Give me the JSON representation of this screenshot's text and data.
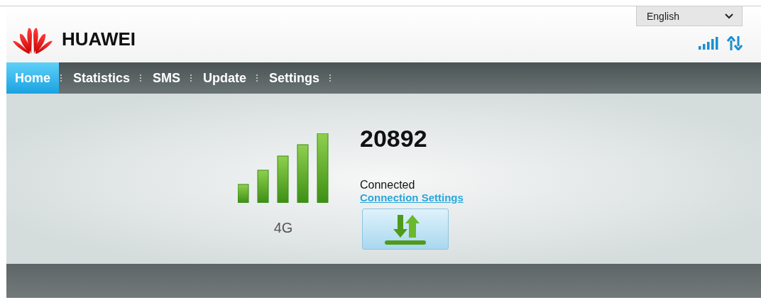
{
  "header": {
    "brand": "HUAWEI",
    "language": {
      "value": "English"
    }
  },
  "nav": [
    {
      "label": "Home",
      "selected": true
    },
    {
      "label": "Statistics",
      "selected": false
    },
    {
      "label": "SMS",
      "selected": false
    },
    {
      "label": "Update",
      "selected": false
    },
    {
      "label": "Settings",
      "selected": false
    }
  ],
  "status": {
    "network_type": "4G",
    "operator": "20892",
    "connection": "Connected",
    "settings_link": "Connection Settings",
    "connected": true
  }
}
